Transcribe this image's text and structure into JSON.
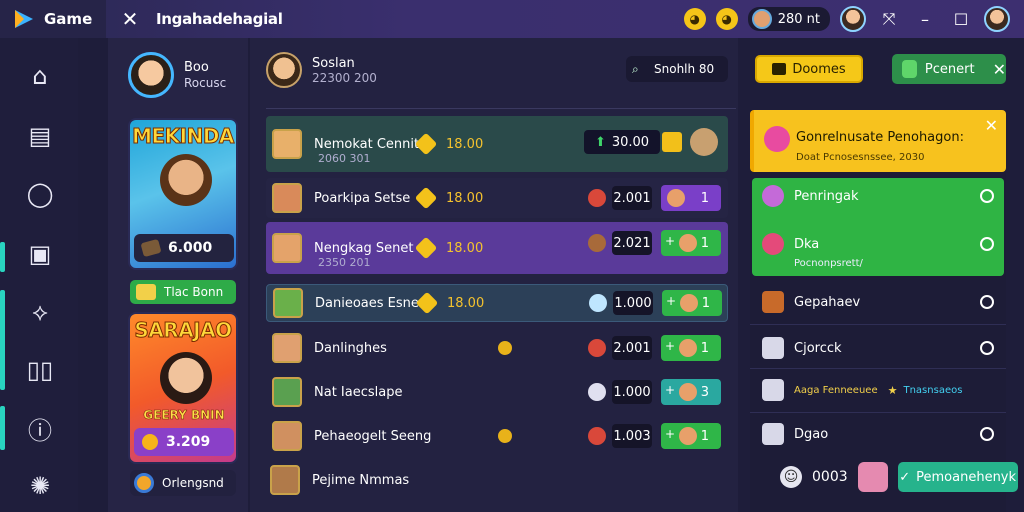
{
  "titlebar": {
    "app_name": "Game",
    "window_title": "Ingahadehagial",
    "coins": "280 nt",
    "icons": [
      "game-logo-icon",
      "close-icon",
      "emoji-icon",
      "emoji-icon",
      "avatar-icon",
      "pin-icon",
      "minimize-icon",
      "maximize-icon",
      "profile-avatar-icon"
    ]
  },
  "leftnav": {
    "icons": [
      "home-icon",
      "shop-icon",
      "circle-icon",
      "bag-icon",
      "fire-icon",
      "columns-icon",
      "info-icon",
      "settings-icon"
    ]
  },
  "profile": {
    "name": "Boo",
    "sub": "Rocusc",
    "card_a": {
      "title": "MEKINDA",
      "value": "6.000"
    },
    "green_button": "Tlac Bonn",
    "card_b": {
      "title": "SARAJAO",
      "subtitle": "GEERY BNIN",
      "value": "3.209"
    },
    "footer": "Orlengsnd"
  },
  "center": {
    "user": {
      "name": "Soslan",
      "sub": "22300 200"
    },
    "search": "Snohlh 80",
    "rows": [
      {
        "name": "Nemokat Cennit",
        "sub": "2060 301",
        "score": "18.00",
        "value": "30.00",
        "chip": ""
      },
      {
        "name": "Poarkipa Setse",
        "sub": "",
        "score": "18.00",
        "value": "2.001",
        "chip": "1"
      },
      {
        "name": "Nengkag Senet",
        "sub": "2350 201",
        "score": "18.00",
        "value": "2.021",
        "chip": "1"
      },
      {
        "name": "Danieoaes Esnea",
        "sub": "",
        "score": "18.00",
        "value": "1.000",
        "chip": "1"
      },
      {
        "name": "Danlinghes",
        "sub": "",
        "score": "",
        "value": "2.001",
        "chip": "1"
      },
      {
        "name": "Nat Iaecslape",
        "sub": "",
        "score": "",
        "value": "1.000",
        "chip": "3"
      },
      {
        "name": "Pehaeogelt Seeng",
        "sub": "",
        "score": "",
        "value": "1.003",
        "chip": "1"
      },
      {
        "name": "Pejime Nmmas",
        "sub": "",
        "score": "",
        "value": "",
        "chip": ""
      }
    ]
  },
  "right": {
    "yellow_button": "Doomes",
    "green_button": "Pcenert",
    "promo": {
      "title": "Gonrelnusate Penohagon:",
      "sub": "Doat Pcnosesnssee, 2030"
    },
    "items": [
      {
        "label": "Penringak",
        "small": ""
      },
      {
        "label": "Dka",
        "small": "Pocnonpsrett/"
      },
      {
        "label": "Gepahaev",
        "small": ""
      },
      {
        "label": "Cjorcck",
        "small": ""
      },
      {
        "label": "Aaga Fenneeuee",
        "small": "Tnasnsaeos"
      },
      {
        "label": "Dgao",
        "small": ""
      }
    ],
    "bottom_value": "0003",
    "teal_button": "Pemoanehenyk"
  },
  "colors": {
    "accent_teal": "#29d4c0",
    "green": "#2fb648",
    "yellow": "#f5c818",
    "purple_row": "#5a3a9a"
  }
}
